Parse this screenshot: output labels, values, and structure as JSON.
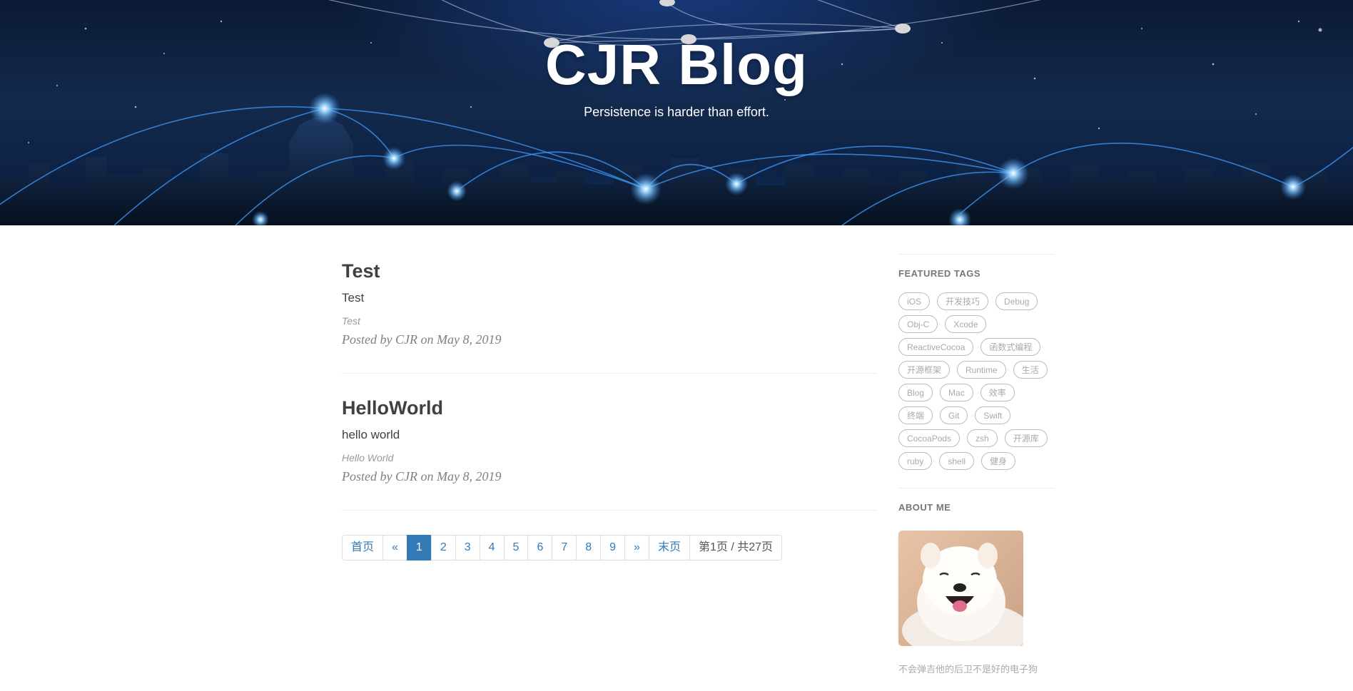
{
  "header": {
    "title": "CJR Blog",
    "subtitle": "Persistence is harder than effort."
  },
  "posts": [
    {
      "title": "Test",
      "subtitle": "Test",
      "excerpt": "Test",
      "meta": "Posted by CJR on May 8, 2019"
    },
    {
      "title": "HelloWorld",
      "subtitle": "hello world",
      "excerpt": "Hello World",
      "meta": "Posted by CJR on May 8, 2019"
    }
  ],
  "pagination": {
    "items": [
      "首页",
      "«",
      "1",
      "2",
      "3",
      "4",
      "5",
      "6",
      "7",
      "8",
      "9",
      "»",
      "末页",
      "第1页 / 共27页"
    ],
    "active": "1"
  },
  "sidebar": {
    "featured_heading": "FEATURED TAGS",
    "tags": [
      "iOS",
      "开发技巧",
      "Debug",
      "Obj-C",
      "Xcode",
      "ReactiveCocoa",
      "函数式编程",
      "开源框架",
      "Runtime",
      "生活",
      "Blog",
      "Mac",
      "效率",
      "终端",
      "Git",
      "Swift",
      "CocoaPods",
      "zsh",
      "开源库",
      "ruby",
      "shell",
      "健身"
    ],
    "about_heading": "ABOUT ME",
    "about_text": "不会弹吉他的后卫不是好的电子狗"
  },
  "colors": {
    "link": "#337ab7",
    "hero_dark": "#0b1a33",
    "hero_glow": "#3a8ae8"
  }
}
